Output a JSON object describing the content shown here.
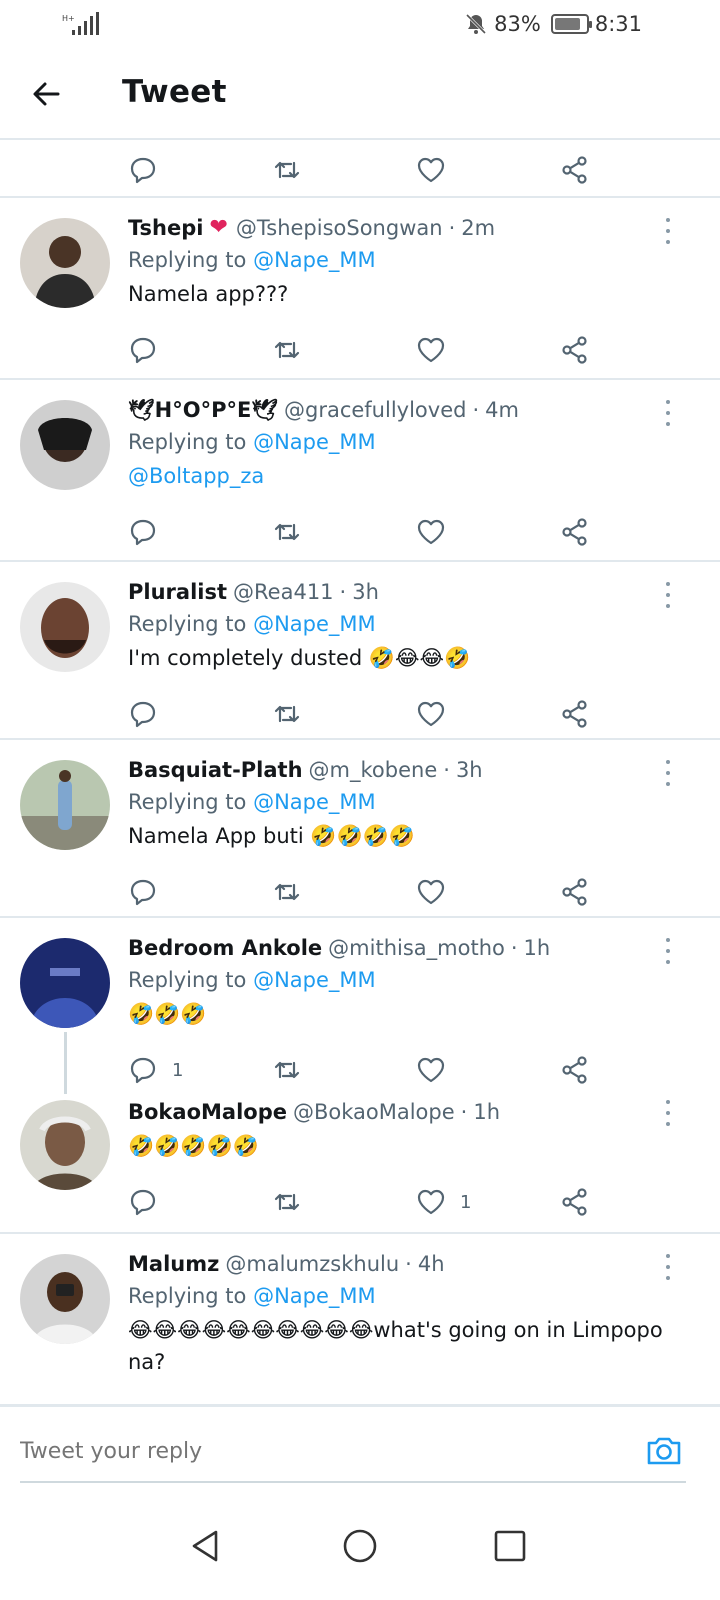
{
  "status_bar": {
    "network": "H+",
    "battery": "83%",
    "battery_level": 0.83,
    "time": "8:31"
  },
  "header": {
    "title": "Tweet"
  },
  "tweets": [
    {
      "name": "Tshepi",
      "badge": "❤",
      "handle": "@TshepisoSongwan",
      "time": "2m",
      "replying_label": "Replying to",
      "replying_to": "@Nape_MM",
      "body": "Namela app???"
    },
    {
      "name": "🕊H°O°P°E🕊",
      "handle": "@gracefullyloved",
      "time": "4m",
      "replying_label": "Replying to",
      "replying_to": "@Nape_MM",
      "body": "@Boltapp_za"
    },
    {
      "name": "Pluralist",
      "handle": "@Rea411",
      "time": "3h",
      "replying_label": "Replying to",
      "replying_to": "@Nape_MM",
      "body": "I'm completely dusted 🤣😂😂🤣"
    },
    {
      "name": "Basquiat-Plath",
      "handle": "@m_kobene",
      "time": "3h",
      "replying_label": "Replying to",
      "replying_to": "@Nape_MM",
      "body": "Namela App buti 🤣🤣🤣🤣"
    },
    {
      "name": "Bedroom Ankole",
      "handle": "@mithisa_motho",
      "time": "1h",
      "replying_label": "Replying to",
      "replying_to": "@Nape_MM",
      "body": "🤣🤣🤣",
      "reply_count": "1"
    },
    {
      "name": "BokaoMalope",
      "handle": "@BokaoMalope",
      "time": "1h",
      "body": "🤣🤣🤣🤣🤣",
      "like_count": "1"
    },
    {
      "name": "Malumz",
      "handle": "@malumzskhulu",
      "time": "4h",
      "replying_label": "Replying to",
      "replying_to": "@Nape_MM",
      "body": "😂😂😂😂😂😂😂😂😂😂what's going on in Limpopo na?"
    }
  ],
  "composer": {
    "placeholder": "Tweet your reply"
  },
  "colors": {
    "accent": "#1d9bf0",
    "heart": "#e0245e",
    "divider": "#e1e8ed"
  },
  "icons": [
    "back-arrow-icon",
    "reply-icon",
    "retweet-icon",
    "like-icon",
    "share-icon",
    "more-icon",
    "camera-icon",
    "nav-back-icon",
    "nav-home-icon",
    "nav-recent-icon"
  ]
}
